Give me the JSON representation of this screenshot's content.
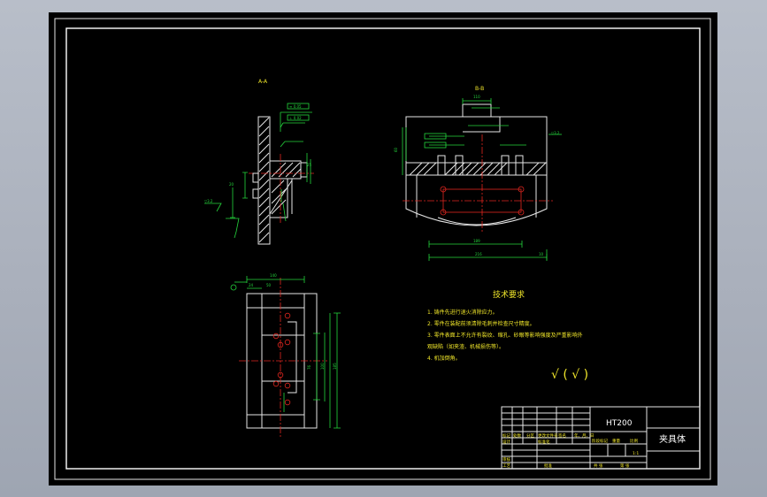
{
  "section_labels": {
    "a_view": "A-A",
    "b_view": "B-B"
  },
  "tech_requirements": {
    "title": "技术要求",
    "items": [
      "1. 铸件先进行退火消除应力。",
      "2. 零件在装配前须清除毛刺并检查尺寸精度。",
      "3. 零件表面上不允许有裂纹、缩孔、砂眼等影响强度及严重影响外",
      "观缺陷（如夹渣、机械损伤等）。",
      "4. 机加倒角。"
    ]
  },
  "roughness_symbol": "√ ( √ )",
  "title_block": {
    "material": "HT200",
    "part_name": "夹具体",
    "labels": {
      "mark": "标记",
      "count": "处数",
      "zone": "分区",
      "change_doc": "更改文件号",
      "signature": "签名",
      "date": "年、月、日",
      "design": "设计",
      "standardize": "标准化",
      "stage_mark": "阶段标记",
      "weight": "重量",
      "scale": "比例",
      "review": "审核",
      "craft": "工艺",
      "approve": "批准",
      "sheets_total": "共 张",
      "sheet_no": "第 张",
      "scale_value": "1:1"
    }
  },
  "dimensions": {
    "a1": "110",
    "a2": "60",
    "a3": "40",
    "a4": "30",
    "b1": "60",
    "b2": "150",
    "b3": "189",
    "b4": "216",
    "b5": "10",
    "c1": "140",
    "c2": "24",
    "c3": "50",
    "c4": "76",
    "c5": "100",
    "c6": "185"
  }
}
